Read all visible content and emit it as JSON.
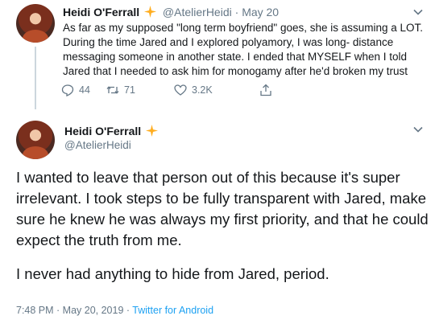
{
  "tweet1": {
    "display_name": "Heidi O'Ferrall",
    "handle": "@AtelierHeidi",
    "separator": "·",
    "date": "May 20",
    "text": "As far as my supposed \"long term boyfriend\" goes, she is assuming a LOT. During the time Jared and I explored polyamory, I was long- distance messaging someone in another state. I ended that MYSELF when I told Jared that I needed to ask him for monogamy after he'd broken my trust",
    "actions": {
      "reply_count": "44",
      "retweet_count": "71",
      "like_count": "3.2K"
    }
  },
  "tweet2": {
    "display_name": "Heidi O'Ferrall",
    "handle": "@AtelierHeidi",
    "paragraph1": "I wanted to leave that person out of this because it's super irrelevant. I took steps to be fully transparent with Jared, make sure he knew he was always my first priority, and that he could expect the truth from me.",
    "paragraph2": "I never had anything to hide from Jared, period.",
    "time": "7:48 PM · May 20, 2019 · ",
    "source": "Twitter for Android"
  },
  "colors": {
    "accent": "#1da1f2",
    "badge": "#ffad1f",
    "muted": "#657786"
  },
  "icons": [
    "sparkle-badge-icon",
    "chevron-down-icon",
    "reply-icon",
    "retweet-icon",
    "heart-icon",
    "share-icon"
  ]
}
